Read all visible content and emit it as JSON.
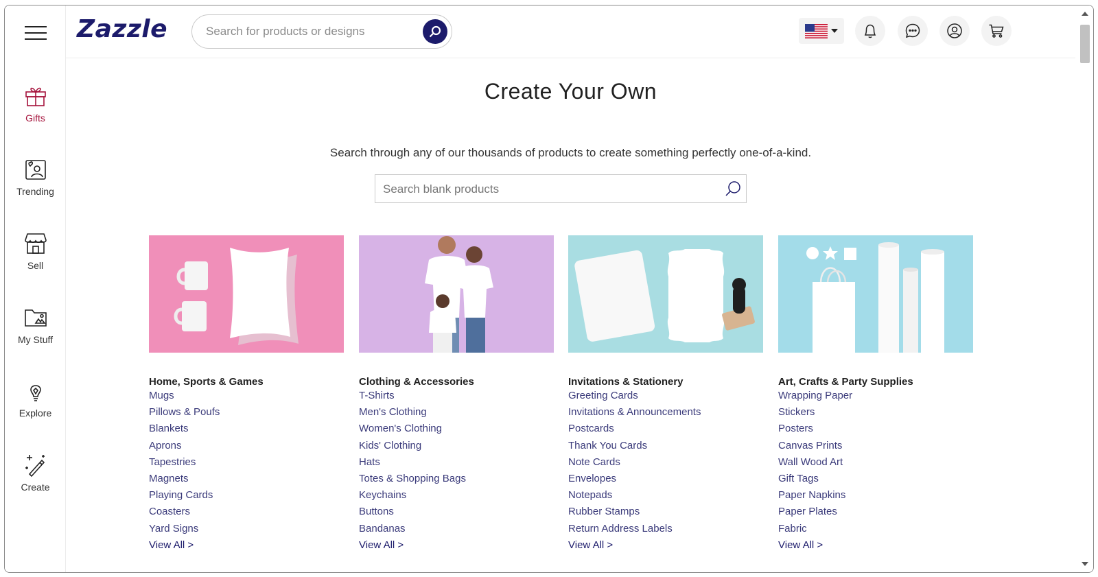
{
  "brand": {
    "logo_text": "Zazzle"
  },
  "header": {
    "search_placeholder": "Search for products or designs",
    "icons": [
      "us-flag-icon",
      "bell-icon",
      "chat-icon",
      "account-icon",
      "cart-icon"
    ]
  },
  "rail": {
    "items": [
      {
        "label": "Gifts",
        "icon": "gift-icon",
        "active": true
      },
      {
        "label": "Trending",
        "icon": "trending-icon"
      },
      {
        "label": "Sell",
        "icon": "store-icon"
      },
      {
        "label": "My Stuff",
        "icon": "folder-icon"
      },
      {
        "label": "Explore",
        "icon": "lightbulb-icon"
      },
      {
        "label": "Create",
        "icon": "magic-wand-icon"
      }
    ]
  },
  "main": {
    "title": "Create Your Own",
    "subtitle": "Search through any of our thousands of products to create something perfectly one-of-a-kind.",
    "blank_search_placeholder": "Search blank products"
  },
  "categories": [
    {
      "heading": "Home, Sports & Games",
      "items": [
        "Mugs",
        "Pillows & Poufs",
        "Blankets",
        "Aprons",
        "Tapestries",
        "Magnets",
        "Playing Cards",
        "Coasters",
        "Yard Signs"
      ],
      "view_all": "View All >",
      "bg": "#f08fb9"
    },
    {
      "heading": "Clothing & Accessories",
      "items": [
        "T-Shirts",
        "Men's Clothing",
        "Women's Clothing",
        "Kids' Clothing",
        "Hats",
        "Totes & Shopping Bags",
        "Keychains",
        "Buttons",
        "Bandanas"
      ],
      "view_all": "View All >",
      "bg": "#d7b3e6"
    },
    {
      "heading": "Invitations & Stationery",
      "items": [
        "Greeting Cards",
        "Invitations & Announcements",
        "Postcards",
        "Thank You Cards",
        "Note Cards",
        "Envelopes",
        "Notepads",
        "Rubber Stamps",
        "Return Address Labels"
      ],
      "view_all": "View All >",
      "bg": "#a9dde2"
    },
    {
      "heading": "Art, Crafts & Party Supplies",
      "items": [
        "Wrapping Paper",
        "Stickers",
        "Posters",
        "Canvas Prints",
        "Wall Wood Art",
        "Gift Tags",
        "Paper Napkins",
        "Paper Plates",
        "Fabric"
      ],
      "view_all": "View All >",
      "bg": "#a3dce9"
    }
  ],
  "colors": {
    "brand_navy": "#1c1b6b",
    "accent_red": "#a5123b"
  }
}
